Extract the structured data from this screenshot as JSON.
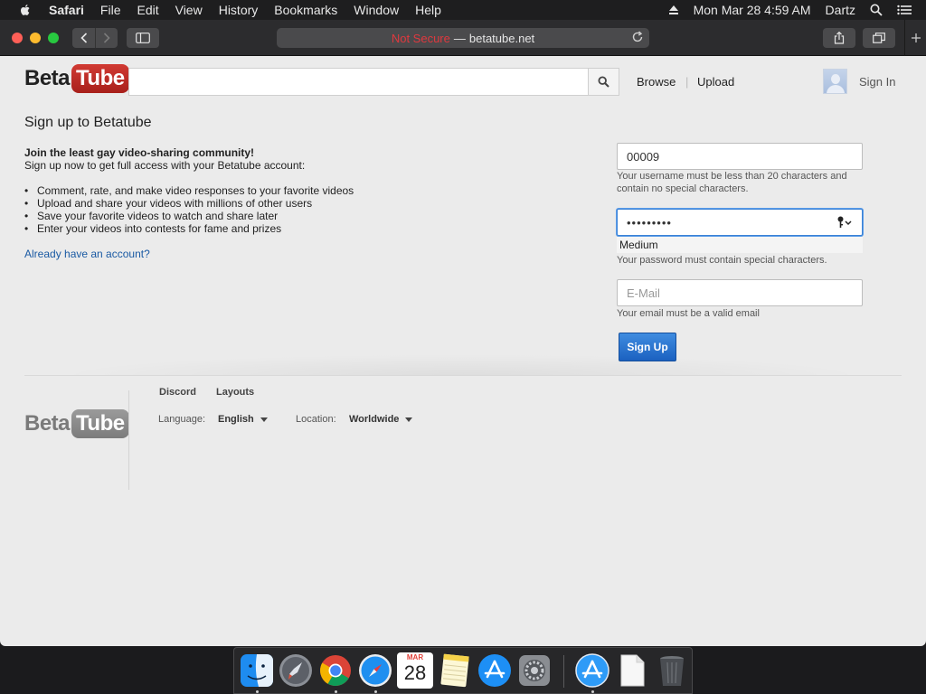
{
  "menubar": {
    "app_name": "Safari",
    "menus": [
      "File",
      "Edit",
      "View",
      "History",
      "Bookmarks",
      "Window",
      "Help"
    ],
    "clock": "Mon Mar 28  4:59 AM",
    "user": "Dartz"
  },
  "browser": {
    "security_label": "Not Secure",
    "separator": "—",
    "domain": "betatube.net"
  },
  "site": {
    "logo_beta": "Beta",
    "logo_tube": "Tube",
    "search_placeholder": "",
    "nav_browse": "Browse",
    "nav_separator": "|",
    "nav_upload": "Upload",
    "sign_in": "Sign In"
  },
  "signup": {
    "title": "Sign up to Betatube",
    "intro_heading": "Join the least gay video-sharing community!",
    "intro_text": "Sign up now to get full access with your Betatube account:",
    "features": [
      "Comment, rate, and make video responses to your favorite videos",
      "Upload and share your videos with millions of other users",
      "Save your favorite videos to watch and share later",
      "Enter your videos into contests for fame and prizes"
    ],
    "already_link": "Already have an account?",
    "username_value": "00009",
    "username_hint": "Your username must be less than 20 characters and contain no special characters.",
    "password_value": "•••••••••",
    "password_strength": "Medium",
    "password_hint": "Your password must contain special characters.",
    "email_placeholder": "E-Mail",
    "email_hint": "Your email must be a valid email",
    "submit_label": "Sign Up"
  },
  "footer": {
    "logo_beta": "Beta",
    "logo_tube": "Tube",
    "link_discord": "Discord",
    "link_layouts": "Layouts",
    "language_label": "Language:",
    "language_value": "English",
    "location_label": "Location:",
    "location_value": "Worldwide"
  },
  "dock": {
    "calendar_month": "MAR",
    "calendar_day": "28",
    "items": [
      "finder",
      "launchpad",
      "chrome",
      "safari",
      "calendar",
      "notes",
      "app-store",
      "system-preferences",
      "app-store-download",
      "document",
      "trash"
    ]
  }
}
